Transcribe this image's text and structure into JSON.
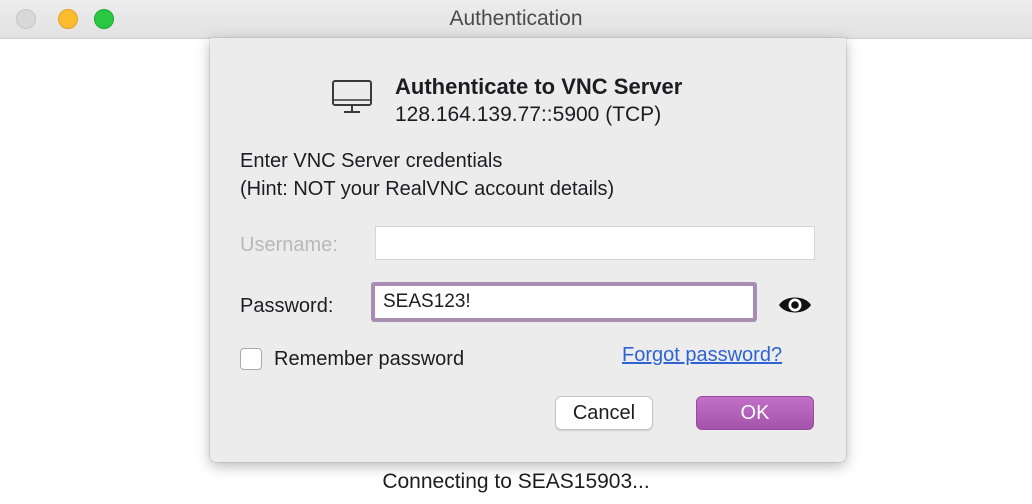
{
  "window": {
    "title": "Authentication"
  },
  "dialog": {
    "icon": "monitor-icon",
    "title": "Authenticate to VNC Server",
    "server": "128.164.139.77::5900 (TCP)",
    "instruction_line1": "Enter VNC Server credentials",
    "instruction_line2": "(Hint: NOT your RealVNC account details)",
    "username_label": "Username:",
    "username_value": "",
    "password_label": "Password:",
    "password_value": "SEAS123!",
    "show_password_icon": "eye-icon",
    "remember_label": "Remember password",
    "remember_checked": false,
    "forgot_link": "Forgot password?",
    "cancel_label": "Cancel",
    "ok_label": "OK"
  },
  "status_text": "Connecting to SEAS15903...",
  "colors": {
    "accent_purple": "#a453ab",
    "focus_ring": "#a98db3",
    "link_blue": "#2f63d3",
    "traffic_min": "#fdbc2e",
    "traffic_max": "#28c840"
  }
}
